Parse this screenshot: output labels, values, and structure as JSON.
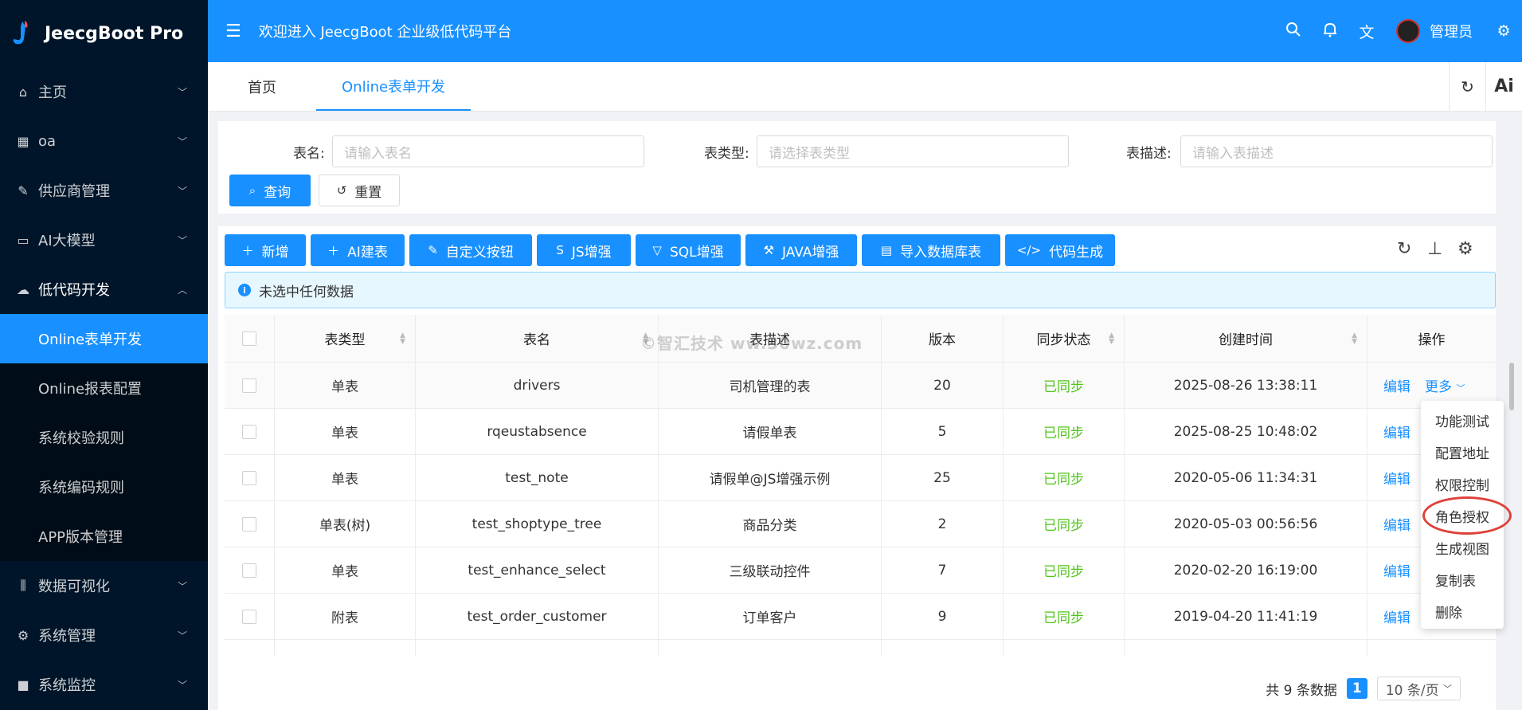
{
  "app": {
    "title": "JeecgBoot Pro"
  },
  "sidebar": {
    "items": [
      {
        "label": "主页",
        "icon": "home-icon"
      },
      {
        "label": "oa",
        "icon": "grid-icon"
      },
      {
        "label": "供应商管理",
        "icon": "pen-icon"
      },
      {
        "label": "AI大模型",
        "icon": "chip-icon"
      },
      {
        "label": "低代码开发",
        "icon": "cloud-icon"
      }
    ],
    "subitems": [
      {
        "label": "Online表单开发",
        "active": true
      },
      {
        "label": "Online报表配置"
      },
      {
        "label": "系统校验规则"
      },
      {
        "label": "系统编码规则"
      },
      {
        "label": "APP版本管理"
      }
    ],
    "bottom_items": [
      {
        "label": "数据可视化",
        "icon": "sliders-icon"
      },
      {
        "label": "系统管理",
        "icon": "gear-icon"
      },
      {
        "label": "系统监控",
        "icon": "camera-icon"
      }
    ]
  },
  "header": {
    "welcome": "欢迎进入 JeecgBoot 企业级低代码平台",
    "user": "管理员"
  },
  "tabs": [
    {
      "label": "首页"
    },
    {
      "label": "Online表单开发",
      "active": true
    }
  ],
  "tab_tools": {
    "ai": "Ai"
  },
  "search": {
    "name_label": "表名:",
    "name_placeholder": "请输入表名",
    "type_label": "表类型:",
    "type_placeholder": "请选择表类型",
    "desc_label": "表描述:",
    "desc_placeholder": "请输入表描述",
    "query": "查询",
    "reset": "重置"
  },
  "toolbar": {
    "add": "新增",
    "ai_build": "AI建表",
    "custom_button": "自定义按钮",
    "js": "JS增强",
    "sql": "SQL增强",
    "java": "JAVA增强",
    "import_db": "导入数据库表",
    "codegen": "代码生成"
  },
  "alert": {
    "text": "未选中任何数据"
  },
  "table": {
    "headers": [
      "表类型",
      "表名",
      "表描述",
      "版本",
      "同步状态",
      "创建时间",
      "操作"
    ],
    "rows": [
      {
        "type": "单表",
        "name": "drivers",
        "desc": "司机管理的表",
        "version": "20",
        "status": "已同步",
        "created": "2025-08-26 13:38:11"
      },
      {
        "type": "单表",
        "name": "rqeustabsence",
        "desc": "请假单表",
        "version": "5",
        "status": "已同步",
        "created": "2025-08-25 10:48:02"
      },
      {
        "type": "单表",
        "name": "test_note",
        "desc": "请假单@JS增强示例",
        "version": "25",
        "status": "已同步",
        "created": "2020-05-06 11:34:31"
      },
      {
        "type": "单表(树)",
        "name": "test_shoptype_tree",
        "desc": "商品分类",
        "version": "2",
        "status": "已同步",
        "created": "2020-05-03 00:56:56"
      },
      {
        "type": "单表",
        "name": "test_enhance_select",
        "desc": "三级联动控件",
        "version": "7",
        "status": "已同步",
        "created": "2020-02-20 16:19:00"
      },
      {
        "type": "附表",
        "name": "test_order_customer",
        "desc": "订单客户",
        "version": "9",
        "status": "已同步",
        "created": "2019-04-20 11:41:19"
      }
    ],
    "edit": "编辑",
    "more": "更多"
  },
  "dropdown": {
    "items": [
      "功能测试",
      "配置地址",
      "权限控制",
      "角色授权",
      "生成视图",
      "复制表",
      "删除"
    ]
  },
  "pagination": {
    "total": "共 9 条数据",
    "page": "1",
    "size": "10 条/页"
  },
  "watermark": "©智汇技术 ww.30wz.com",
  "colors": {
    "primary": "#1890ff",
    "sidebar": "#001529",
    "success": "#52c41a",
    "highlight": "#e0403a"
  }
}
